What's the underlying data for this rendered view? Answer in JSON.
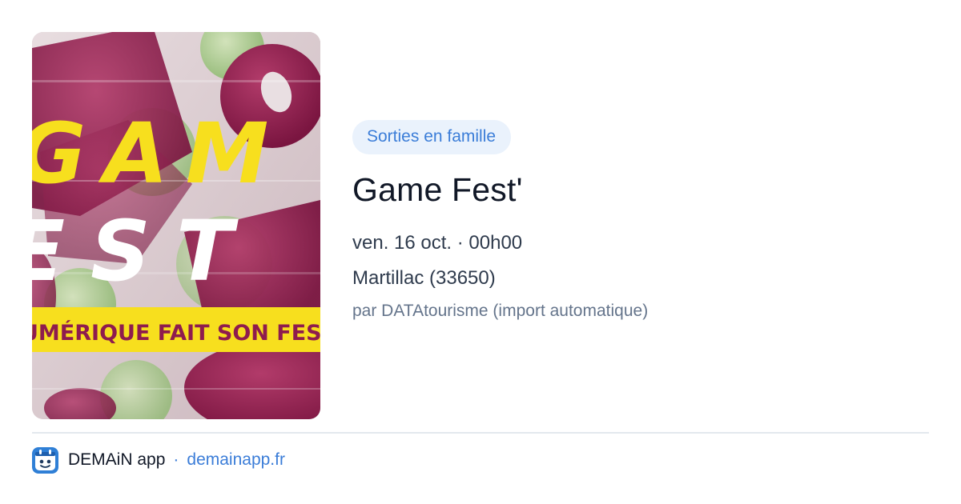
{
  "event": {
    "category": "Sorties en famille",
    "title": "Game Fest'",
    "datetime": "ven. 16 oct. · 00h00",
    "location": "Martillac (33650)",
    "source": "par DATAtourisme (import automatique)"
  },
  "poster": {
    "line1": "GAM",
    "line2": "EST",
    "banner": "UMÉRIQUE FAIT SON FEST"
  },
  "footer": {
    "app_name": "DEMAiN app",
    "separator": "·",
    "link": "demainapp.fr",
    "icon": "app-logo-icon"
  },
  "colors": {
    "accent": "#3b7dd8",
    "tag_bg": "#eaf2fc",
    "poster_yellow": "#f7df1e",
    "poster_magenta": "#8e1c4e"
  }
}
